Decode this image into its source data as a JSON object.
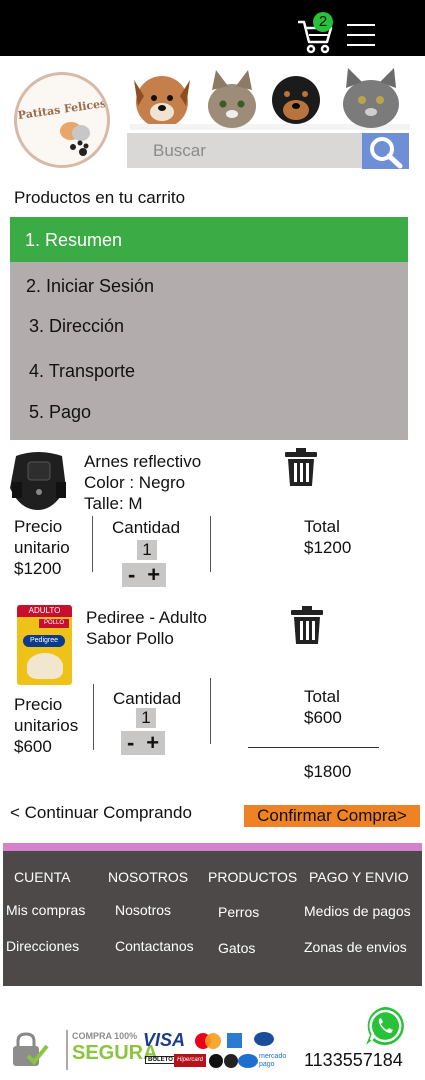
{
  "topbar": {
    "cart_count": "2",
    "cart_icon": "cart-icon",
    "menu_icon": "hamburger-menu-icon"
  },
  "header": {
    "logo_text": "Patitas Felices",
    "search_placeholder": "Buscar",
    "search_icon": "magnifier-icon"
  },
  "cart_title": "Productos en tu carrito",
  "steps": [
    {
      "label": "1. Resumen",
      "active": true
    },
    {
      "label": "2. Iniciar Sesión"
    },
    {
      "label": "3. Dirección"
    },
    {
      "label": "4. Transporte"
    },
    {
      "label": "5. Pago"
    }
  ],
  "products": [
    {
      "name": "Arnes reflectivo",
      "color": "Color : Negro",
      "size": "Talle: M",
      "price_label_1": "Precio",
      "price_label_2": "unitario",
      "price": "$1200",
      "qty_label": "Cantidad",
      "qty": "1",
      "minus": "-",
      "plus": "+",
      "total_label": "Total",
      "total": "$1200"
    },
    {
      "name": "Pedire e - Adulto",
      "flavor": "Sabor Pollo",
      "package_text_top": "ADULTO",
      "package_text_pollo": "POLLO",
      "package_brand": "Pedigree",
      "price_label_1": "Precio",
      "price_label_2": "unitarios",
      "price": "$600",
      "qty_label": "Cantidad",
      "qty": "1",
      "minus": "-",
      "plus": "+",
      "total_label": "Total",
      "total": "$600"
    }
  ],
  "grand_total": "$1800",
  "actions": {
    "continue": "< Continuar Comprando",
    "confirm": "Confirmar Compra>"
  },
  "footer": {
    "columns": [
      {
        "heading": "CUENTA",
        "links": [
          "Mis compras",
          "Direcciones"
        ]
      },
      {
        "heading": "NOSOTROS",
        "links": [
          "Nosotros",
          "Contactanos"
        ]
      },
      {
        "heading": "PRODUCTOS",
        "links": [
          "Perros",
          "Gatos"
        ]
      },
      {
        "heading": "PAGO Y ENVIO",
        "links": [
          "Medios de pagos",
          "Zonas de envios"
        ]
      }
    ]
  },
  "bottom": {
    "secure_line1": "COMPRA 100%",
    "secure_line2": "SEGURA",
    "payment_visa": "VISA",
    "payment_hipercard": "Hipercard",
    "payment_boleto": "BOLETO",
    "payment_mercadopago": "mercado pago",
    "phone": "1133557184",
    "whatsapp_icon": "whatsapp-icon"
  },
  "colors": {
    "topbar": "#000000",
    "active_step": "#3aab45",
    "steps_bg": "#b3acad",
    "confirm": "#f08226",
    "footer": "#4e4949",
    "footer_accent": "#d582ce",
    "search_button": "#6e8fd6"
  }
}
